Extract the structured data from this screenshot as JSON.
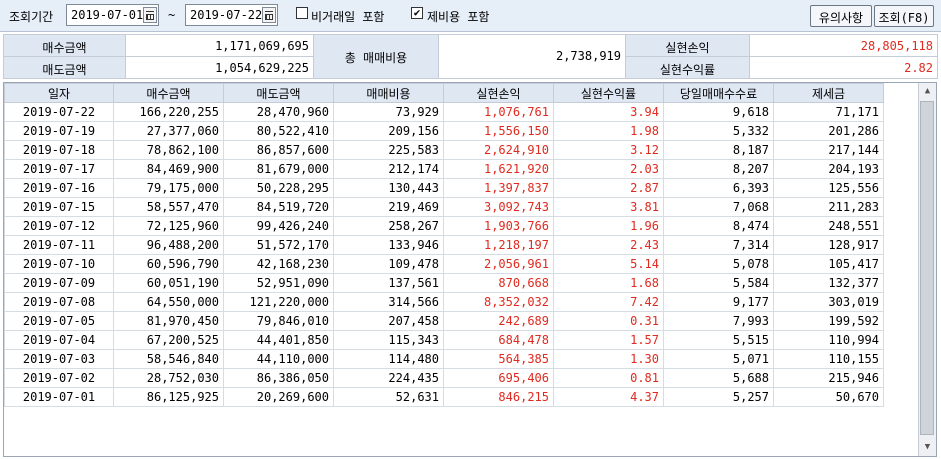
{
  "toolbar": {
    "period_label": "조회기간",
    "date_from": "2019-07-01",
    "date_to": "2019-07-22",
    "tilde": "~",
    "check_nontrading": {
      "label": "비거래일 포함",
      "checked": false
    },
    "check_cost": {
      "label": "제비용 포함",
      "checked": true
    },
    "notes_button": "유의사항",
    "query_button": "조회(F8)"
  },
  "summary": {
    "buy_label": "매수금액",
    "buy_value": "1,171,069,695",
    "sell_label": "매도금액",
    "sell_value": "1,054,629,225",
    "cost_label": "총 매매비용",
    "cost_value": "2,738,919",
    "pnl_label": "실현손익",
    "pnl_value": "28,805,118",
    "rate_label": "실현수익률",
    "rate_value": "2.82"
  },
  "table": {
    "headers": [
      "일자",
      "매수금액",
      "매도금액",
      "매매비용",
      "실현손익",
      "실현수익률",
      "당일매매수수료",
      "제세금"
    ],
    "rows": [
      [
        "2019-07-22",
        "166,220,255",
        "28,470,960",
        "73,929",
        "1,076,761",
        "3.94",
        "9,618",
        "71,171"
      ],
      [
        "2019-07-19",
        "27,377,060",
        "80,522,410",
        "209,156",
        "1,556,150",
        "1.98",
        "5,332",
        "201,286"
      ],
      [
        "2019-07-18",
        "78,862,100",
        "86,857,600",
        "225,583",
        "2,624,910",
        "3.12",
        "8,187",
        "217,144"
      ],
      [
        "2019-07-17",
        "84,469,900",
        "81,679,000",
        "212,174",
        "1,621,920",
        "2.03",
        "8,207",
        "204,193"
      ],
      [
        "2019-07-16",
        "79,175,000",
        "50,228,295",
        "130,443",
        "1,397,837",
        "2.87",
        "6,393",
        "125,556"
      ],
      [
        "2019-07-15",
        "58,557,470",
        "84,519,720",
        "219,469",
        "3,092,743",
        "3.81",
        "7,068",
        "211,283"
      ],
      [
        "2019-07-12",
        "72,125,960",
        "99,426,240",
        "258,267",
        "1,903,766",
        "1.96",
        "8,474",
        "248,551"
      ],
      [
        "2019-07-11",
        "96,488,200",
        "51,572,170",
        "133,946",
        "1,218,197",
        "2.43",
        "7,314",
        "128,917"
      ],
      [
        "2019-07-10",
        "60,596,790",
        "42,168,230",
        "109,478",
        "2,056,961",
        "5.14",
        "5,078",
        "105,417"
      ],
      [
        "2019-07-09",
        "60,051,190",
        "52,951,090",
        "137,561",
        "870,668",
        "1.68",
        "5,584",
        "132,377"
      ],
      [
        "2019-07-08",
        "64,550,000",
        "121,220,000",
        "314,566",
        "8,352,032",
        "7.42",
        "9,177",
        "303,019"
      ],
      [
        "2019-07-05",
        "81,970,450",
        "79,846,010",
        "207,458",
        "242,689",
        "0.31",
        "7,993",
        "199,592"
      ],
      [
        "2019-07-04",
        "67,200,525",
        "44,401,850",
        "115,343",
        "684,478",
        "1.57",
        "5,515",
        "110,994"
      ],
      [
        "2019-07-03",
        "58,546,840",
        "44,110,000",
        "114,480",
        "564,385",
        "1.30",
        "5,071",
        "110,155"
      ],
      [
        "2019-07-02",
        "28,752,030",
        "86,386,050",
        "224,435",
        "695,406",
        "0.81",
        "5,688",
        "215,946"
      ],
      [
        "2019-07-01",
        "86,125,925",
        "20,269,600",
        "52,631",
        "846,215",
        "4.37",
        "5,257",
        "50,670"
      ]
    ],
    "red_columns": [
      4,
      5
    ]
  },
  "colors": {
    "profit": "#e02a1f",
    "header_bg": "#dfe7f3",
    "toolbar_bg": "#e6eef8"
  }
}
